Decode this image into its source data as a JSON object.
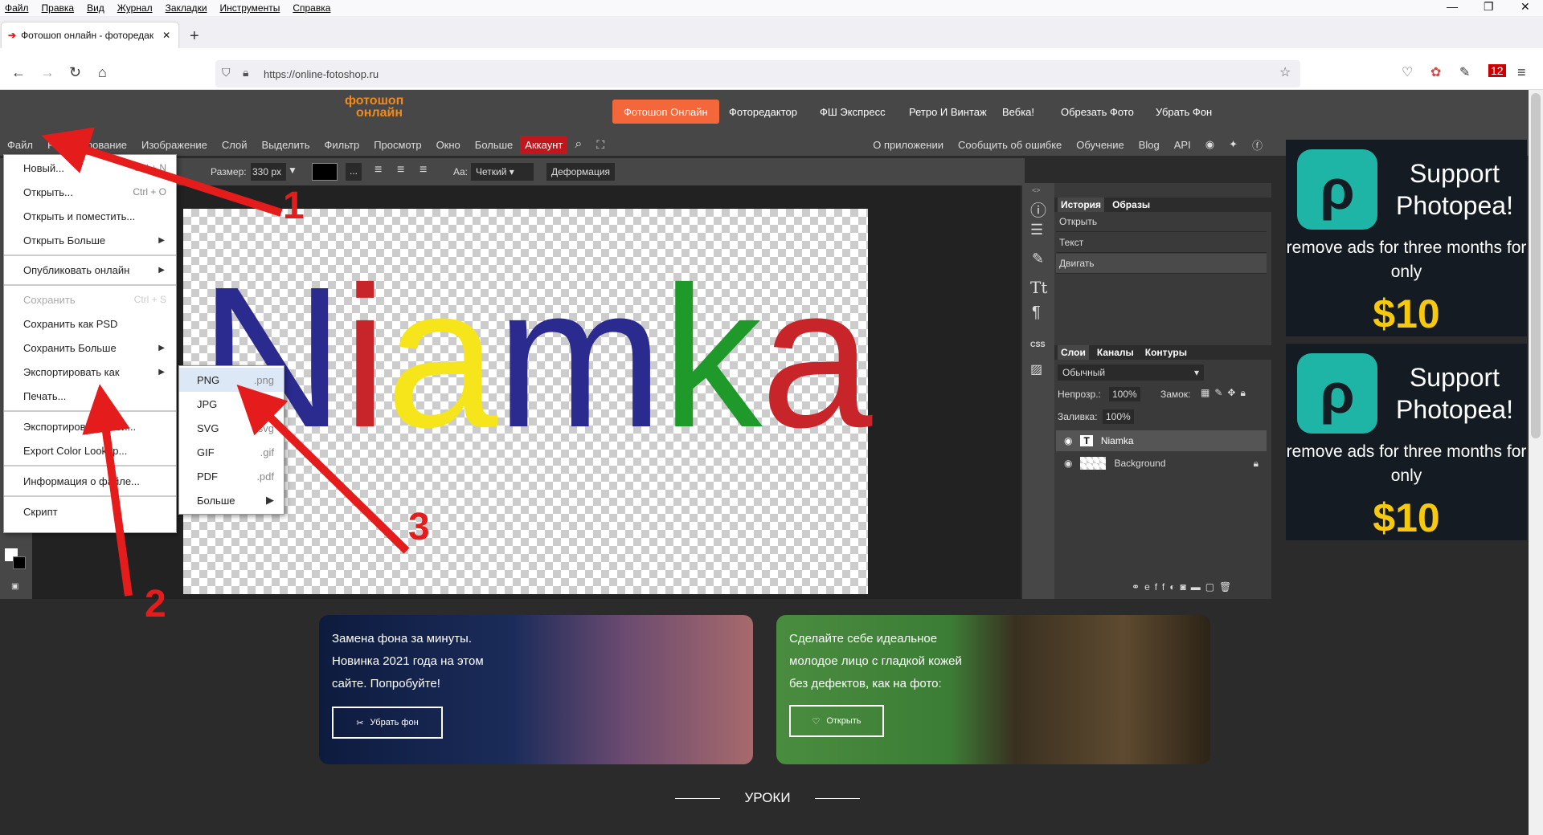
{
  "system_menu": [
    "Файл",
    "Правка",
    "Вид",
    "Журнал",
    "Закладки",
    "Инструменты",
    "Справка"
  ],
  "browser": {
    "tab_title": "Фотошоп онлайн - фоторедак",
    "url": "https://online-fotoshop.ru",
    "new_tab": "+",
    "badge_count": "12"
  },
  "site_nav": {
    "logo_line1": "фотошоп",
    "logo_line2": "онлайн",
    "items": [
      "Фотошоп Онлайн",
      "Фоторедактор",
      "ФШ Экспресс",
      "Ретро И Винтаж",
      "Вебка!",
      "Обрезать Фото",
      "Убрать Фон"
    ]
  },
  "app_menu": {
    "items": [
      "Файл",
      "Редактирование",
      "Изображение",
      "Слой",
      "Выделить",
      "Фильтр",
      "Просмотр",
      "Окно",
      "Больше"
    ],
    "account": "Аккаунт",
    "right_items": [
      "О приложении",
      "Сообщить об ошибке",
      "Обучение",
      "Blog",
      "API"
    ]
  },
  "options_bar": {
    "size_label": "Размер:",
    "size_value": "330 px",
    "ellipsis": "...",
    "aa_label": "Aa:",
    "aa_value": "Четкий",
    "warp": "Деформация"
  },
  "canvas_text": "Niamka",
  "colors": {
    "N": "#2a2a8f",
    "i": "#c8252a",
    "a1": "#f5e51a",
    "m": "#2a2a8f",
    "k": "#1f9a2a",
    "a2": "#c8252a",
    "accent_orange": "#f4673b",
    "account_red": "#c0161e",
    "annotation_red": "#e51c1c"
  },
  "history_panel": {
    "tabs": [
      "История",
      "Образы"
    ],
    "rows": [
      "Открыть",
      "Текст",
      "Двигать"
    ]
  },
  "layers_panel": {
    "tabs": [
      "Слои",
      "Каналы",
      "Контуры"
    ],
    "blend": "Обычный",
    "opacity_label": "Непрозр.:",
    "opacity": "100%",
    "lock_label": "Замок:",
    "fill_label": "Заливка:",
    "fill": "100%",
    "layers": [
      "Niamka",
      "Background"
    ],
    "footer_icons": "eff"
  },
  "file_menu": [
    {
      "label": "Новый...",
      "shortcut": "Ctrl + N"
    },
    {
      "label": "Открыть...",
      "shortcut": "Ctrl + O"
    },
    {
      "label": "Открыть и поместить..."
    },
    {
      "label": "Открыть Больше",
      "arrow": "▶"
    },
    {
      "label": "Опубликовать онлайн",
      "arrow": "▶"
    },
    {
      "label": "Сохранить",
      "shortcut": "Ctrl + S"
    },
    {
      "label": "Сохранить как PSD"
    },
    {
      "label": "Сохранить Больше",
      "arrow": "▶"
    },
    {
      "label": "Экспортировать как",
      "arrow": "▶"
    },
    {
      "label": "Печать..."
    },
    {
      "label": "Экспортировать слои..."
    },
    {
      "label": "Export Color Lookup..."
    },
    {
      "label": "Информация о файле..."
    },
    {
      "label": "Скрипт"
    }
  ],
  "export_submenu": [
    {
      "label": "PNG",
      "ext": ".png"
    },
    {
      "label": "JPG",
      "ext": ".jpg"
    },
    {
      "label": "SVG",
      "ext": ".svg"
    },
    {
      "label": "GIF",
      "ext": ".gif"
    },
    {
      "label": "PDF",
      "ext": ".pdf"
    },
    {
      "label": "Больше",
      "ext": "▶"
    }
  ],
  "ads": {
    "line1": "Support Photopea!",
    "line2": "remove ads for three months for only",
    "price": "$10"
  },
  "banners": [
    {
      "text": [
        "Замена фона за минуты.",
        "Новинка 2021 года на этом",
        "сайте. Попробуйте!"
      ],
      "button": "Убрать фон"
    },
    {
      "text": [
        "Сделайте себе идеальное",
        "молодое лицо с гладкой кожей",
        "без дефектов, как на фото:"
      ],
      "button": "Открыть"
    }
  ],
  "lessons_title": "УРОКИ",
  "annotations": [
    "1",
    "2",
    "3"
  ]
}
